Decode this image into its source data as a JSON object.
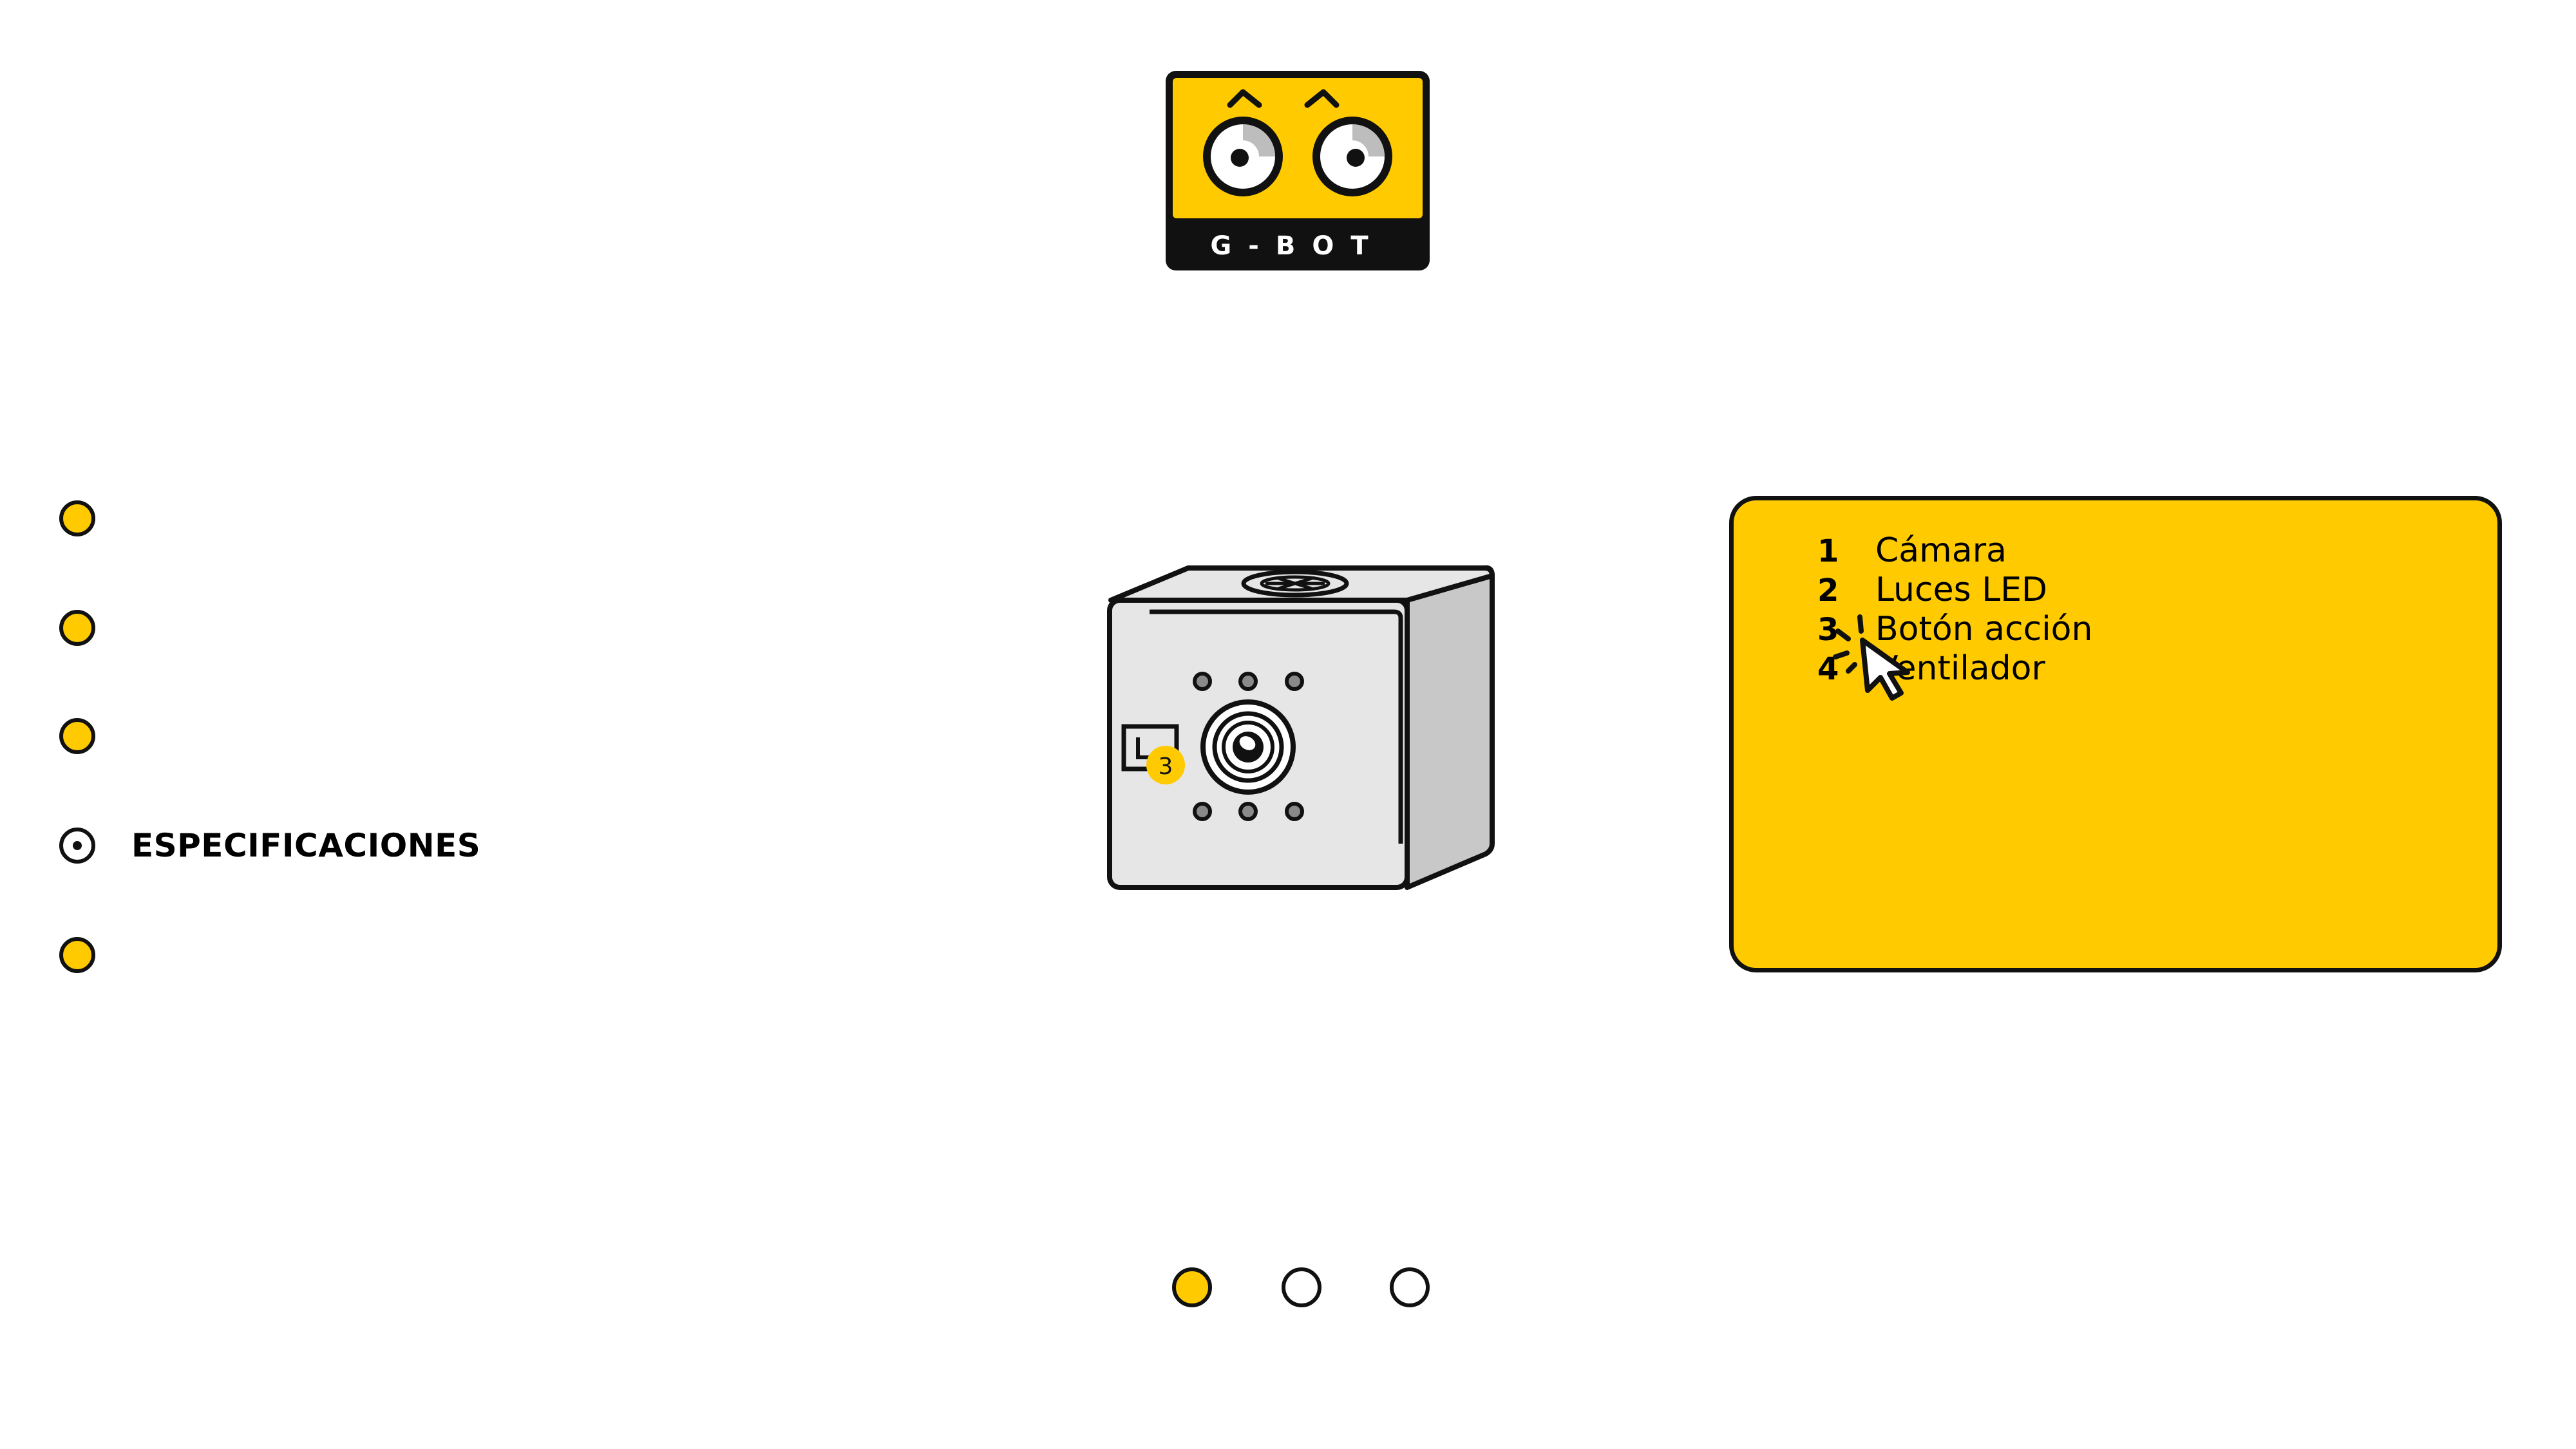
{
  "brand": {
    "logo_text": "G-BOT",
    "colors": {
      "accent": "#FFCB00",
      "ink": "#111111",
      "device_body": "#E6E6E6",
      "device_side": "#C8C8C8"
    }
  },
  "sidebar": {
    "items": [
      {
        "label": "",
        "active": false
      },
      {
        "label": "",
        "active": false
      },
      {
        "label": "",
        "active": false
      },
      {
        "label": "ESPECIFICACIONES",
        "active": true
      },
      {
        "label": "",
        "active": false
      }
    ]
  },
  "device": {
    "callout_badge": "3"
  },
  "info_panel": {
    "specs": [
      {
        "number": "1",
        "label": "Cámara"
      },
      {
        "number": "2",
        "label": "Luces LED"
      },
      {
        "number": "3",
        "label": "Botón acción"
      },
      {
        "number": "4",
        "label": "Ventilador"
      }
    ]
  },
  "pagination": {
    "total": 3,
    "current": 1
  },
  "icons": [
    "gbot-logo-icon",
    "cursor-click-icon",
    "camera-lens-icon",
    "fan-icon",
    "led-light-icon",
    "action-button-icon"
  ]
}
